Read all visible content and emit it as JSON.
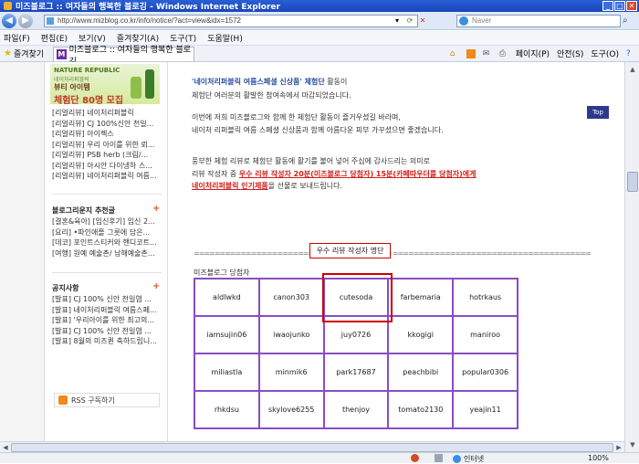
{
  "window": {
    "title": "미즈블로그 :: 여자들의 행복한 블로깅 - Windows Internet Explorer"
  },
  "address": {
    "url": "http://www.mizblog.co.kr/info/notice/?act=view&idx=1572",
    "search_placeholder": "Naver"
  },
  "menu": [
    "파일(F)",
    "편집(E)",
    "보기(V)",
    "즐겨찾기(A)",
    "도구(T)",
    "도움말(H)"
  ],
  "favbar": {
    "favorites_label": "즐겨찾기",
    "tab_title": "미즈블로그 :: 여자들의 행복한 블로깅",
    "tools": [
      "페이지(P)",
      "안전(S)",
      "도구(O)"
    ]
  },
  "sidebar": {
    "banner": {
      "brand": "NATURE REPUBLIC",
      "line2": "네이처리퍼블릭",
      "line3": "뷰티 아이템",
      "line4": "체험단 80명 모집"
    },
    "reviews": [
      "[리얼리뷰] 네이처리퍼블릭",
      "[리얼리뷰] CJ 100%신안 천일...",
      "[리얼리뷰] 아이젝스",
      "[리얼리뷰] 우리 아이를 위한 뢰...",
      "[리얼리뷰] PSB herb (크림/...",
      "[리얼리뷰] 아시안 다이냉하 스...",
      "[리얼리뷰] 네이처리퍼블릭 여름..."
    ],
    "recommend_title": "블로그리운지 추천글",
    "recommend": [
      "[결혼&육아] [임신후기] 임신 2...",
      "[요리] •파인애플 그릇에 담은...",
      "[데코] 포인트스티커와 핸디코트...",
      "[여행] 원예 예술촌/ 남해예술촌..."
    ],
    "notice_title": "공지사항",
    "notices": [
      "[발표] CJ 100% 신안 천일염 ...",
      "[발표] 네이처리퍼블릭 여름스페...",
      "[발표] '우리아이를 위한 최고의...",
      "[발표] CJ 100% 신안 천일염 ...",
      "[발표] 8월의 미즈퀸 축하드립니..."
    ],
    "rss_label": "RSS 구독하기"
  },
  "main": {
    "line1_hl": "'네이처리퍼블릭 여름스페셜 신상품' 체험단",
    "line1_rest": " 활동이",
    "line2": "체험단 여러분의 활발한 참여속에서 마감되었습니다.",
    "line3": "이번에 저희 미즈블로그와 함께 한 체험단 활동이 즐거우셨길 바라며,",
    "line4": "네이처 리퍼블릭 여름 스페셜 신상품과 함께 아름다운 피부 가꾸셨으면 좋겠습니다.",
    "line5": "풍부한 체험 리뷰로 체험단 활동에 활기를 불어 넣어 주심에 감사드리는 의미로",
    "line6_pre": "리뷰 작성자 중 ",
    "line6_red": "우수 리뷰 작성자 20분(미즈블로그 당첨자) 15분(카페따우더를 당첨자)에게",
    "line7_red": "네이처리퍼블릭 인기제품",
    "line7_rest": "을 선물로 보내드립니다.",
    "divider_left": "======================================",
    "divider_right": "======================================",
    "winner_label": "우수 리뷰 작성자 명단",
    "winners_caption": "미즈블로그 당첨자",
    "winners": [
      [
        "aldlwkd",
        "canon303",
        "cutesoda",
        "farbemaria",
        "hotrkaus"
      ],
      [
        "iamsujin06",
        "iwaojunko",
        "juy0726",
        "kkogigi",
        "maniroo"
      ],
      [
        "miliastla",
        "minmik6",
        "park17687",
        "peachbibi",
        "popular0306"
      ],
      [
        "rhkdsu",
        "skylove6255",
        "thenjoy",
        "tomato2130",
        "yeajin11"
      ]
    ],
    "top_button": "Top"
  },
  "status": {
    "zone": "인터넷",
    "zoom": "100%"
  }
}
